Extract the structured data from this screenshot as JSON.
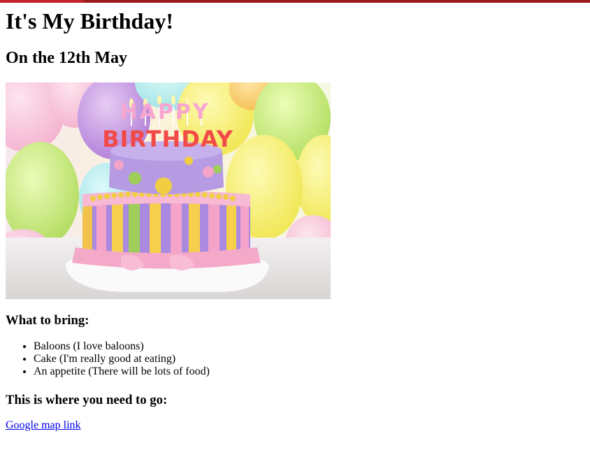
{
  "page": {
    "title": "It's My Birthday!",
    "date_heading": "On the 12th May",
    "cake_candles_text": "HAPPY BIRTHDAY",
    "bring_heading": "What to bring:",
    "bring_items": [
      "Baloons (I love baloons)",
      "Cake (I'm really good at eating)",
      "An appetite (There will be lots of food)"
    ],
    "go_heading": "This is where you need to go:",
    "map_link_label": "Google map link"
  },
  "colors": {
    "top_bar": "#9e1c20",
    "link": "#0000ee"
  }
}
